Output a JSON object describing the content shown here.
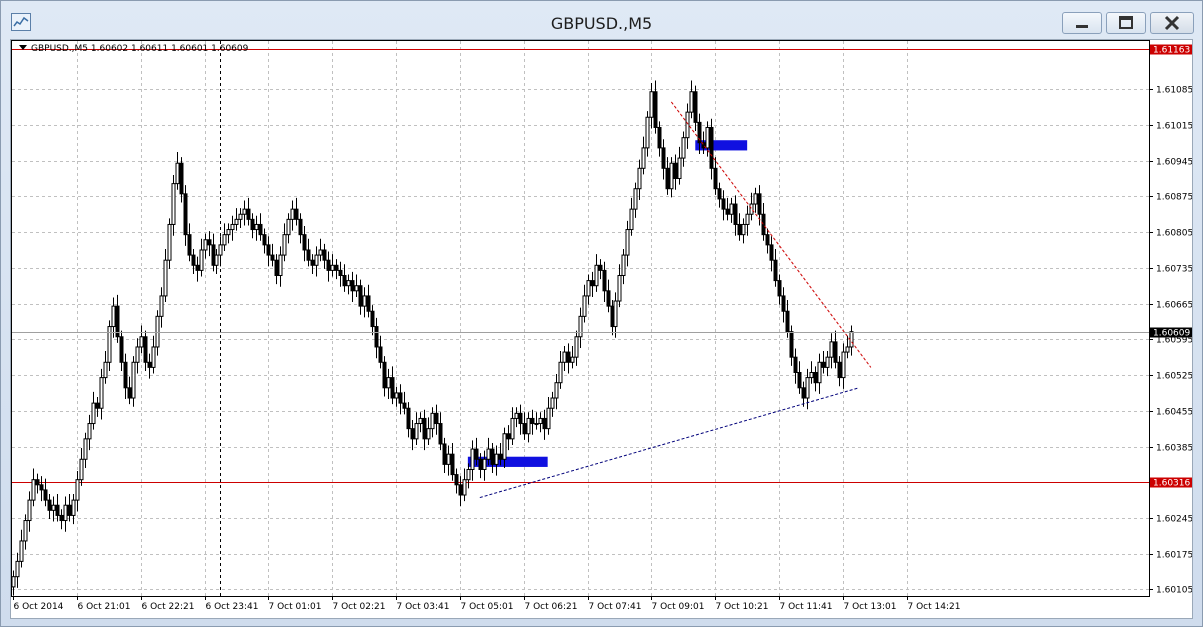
{
  "window": {
    "title": "GBPUSD.,M5",
    "icons": {
      "app": "chart-window-icon",
      "minimize": "minimize-icon",
      "maximize": "maximize-icon",
      "close": "close-icon"
    }
  },
  "chart_header": {
    "symbol": "GBPUSD.,M5",
    "ohlc": "1.60602 1.60611 1.60601 1.60609"
  },
  "colors": {
    "candle": "#000000",
    "level_line": "#cc0000",
    "trendline": "#00007a",
    "rect": "#1010e0",
    "grid": "#c0c0c0",
    "current_price_bg": "#000000"
  },
  "chart_data": {
    "type": "candlestick",
    "symbol": "GBPUSD.",
    "timeframe": "M5",
    "ylim": [
      1.601,
      1.6115
    ],
    "price_axis_labels": [
      "1.61085",
      "1.61015",
      "1.60945",
      "1.60875",
      "1.60805",
      "1.60735",
      "1.60665",
      "1.60595",
      "1.60525",
      "1.60455",
      "1.60385",
      "1.60315",
      "1.60245",
      "1.60175",
      "1.60105"
    ],
    "time_axis_labels": [
      "6 Oct 2014",
      "6 Oct 21:01",
      "6 Oct 22:21",
      "6 Oct 23:41",
      "7 Oct 01:01",
      "7 Oct 02:21",
      "7 Oct 03:41",
      "7 Oct 05:01",
      "7 Oct 06:21",
      "7 Oct 07:41",
      "7 Oct 09:01",
      "7 Oct 10:21",
      "7 Oct 11:41",
      "7 Oct 13:01",
      "7 Oct 14:21"
    ],
    "bars_per_label": 16,
    "horizontal_levels": [
      {
        "price": 1.61163,
        "label": "1.61163"
      },
      {
        "price": 1.60316,
        "label": "1.60316"
      }
    ],
    "current_price": {
      "price": 1.60609,
      "label": "1.60609"
    },
    "rectangles": [
      {
        "start_bar": 114,
        "end_bar": 134,
        "price_top": 1.60365,
        "price_bottom": 1.60345
      },
      {
        "start_bar": 171,
        "end_bar": 184,
        "price_top": 1.60985,
        "price_bottom": 1.60965
      }
    ],
    "trendlines": [
      {
        "bar1": 117,
        "price1": 1.60285,
        "bar2": 212,
        "price2": 1.605,
        "style": "dashed",
        "color": "#00007a"
      },
      {
        "bar1": 165,
        "price1": 1.6106,
        "bar2": 215,
        "price2": 1.6054,
        "style": "dashed",
        "color": "#cc0000"
      }
    ],
    "period_separator_bar": 52,
    "closes": [
      1.6013,
      1.6016,
      1.602,
      1.6024,
      1.6028,
      1.6032,
      1.6031,
      1.603,
      1.6028,
      1.6026,
      1.6027,
      1.6025,
      1.6024,
      1.6027,
      1.6025,
      1.6028,
      1.6032,
      1.6036,
      1.604,
      1.6043,
      1.6047,
      1.6046,
      1.6052,
      1.6055,
      1.6062,
      1.6066,
      1.606,
      1.6055,
      1.605,
      1.6048,
      1.6055,
      1.6058,
      1.606,
      1.6055,
      1.6054,
      1.6058,
      1.6064,
      1.6068,
      1.6075,
      1.6082,
      1.609,
      1.6094,
      1.6088,
      1.608,
      1.6076,
      1.6074,
      1.6073,
      1.6077,
      1.6079,
      1.6078,
      1.6074,
      1.6076,
      1.6078,
      1.608,
      1.6081,
      1.6082,
      1.6083,
      1.6084,
      1.6085,
      1.6083,
      1.6081,
      1.6082,
      1.608,
      1.6078,
      1.6076,
      1.6075,
      1.6072,
      1.6076,
      1.608,
      1.6083,
      1.6085,
      1.6083,
      1.608,
      1.6077,
      1.6075,
      1.6074,
      1.6076,
      1.6077,
      1.6075,
      1.6073,
      1.6074,
      1.6073,
      1.6072,
      1.607,
      1.6071,
      1.6069,
      1.607,
      1.6066,
      1.6068,
      1.6065,
      1.6062,
      1.6058,
      1.6055,
      1.605,
      1.6052,
      1.6048,
      1.6049,
      1.6047,
      1.6046,
      1.6042,
      1.604,
      1.6043,
      1.6044,
      1.604,
      1.6042,
      1.6045,
      1.6043,
      1.6039,
      1.6035,
      1.6037,
      1.6033,
      1.6031,
      1.6029,
      1.6032,
      1.6034,
      1.6038,
      1.6036,
      1.6034,
      1.6036,
      1.6038,
      1.6035,
      1.6037,
      1.6036,
      1.6041,
      1.604,
      1.6044,
      1.6045,
      1.6043,
      1.6041,
      1.6044,
      1.6043,
      1.6043,
      1.6044,
      1.6042,
      1.6046,
      1.6048,
      1.6051,
      1.6055,
      1.6057,
      1.6055,
      1.6056,
      1.606,
      1.6064,
      1.6068,
      1.6071,
      1.607,
      1.6074,
      1.6073,
      1.6069,
      1.6066,
      1.6062,
      1.6067,
      1.6072,
      1.6076,
      1.6081,
      1.6085,
      1.6089,
      1.6093,
      1.6097,
      1.6103,
      1.6108,
      1.6101,
      1.6097,
      1.6093,
      1.6089,
      1.6094,
      1.6091,
      1.6095,
      1.6099,
      1.6104,
      1.6108,
      1.6102,
      1.6098,
      1.6097,
      1.6101,
      1.6093,
      1.6089,
      1.6087,
      1.6085,
      1.6084,
      1.6086,
      1.6082,
      1.608,
      1.6082,
      1.6084,
      1.6086,
      1.6088,
      1.6084,
      1.608,
      1.6078,
      1.6075,
      1.6071,
      1.6068,
      1.6065,
      1.6061,
      1.6056,
      1.6053,
      1.605,
      1.6048,
      1.6052,
      1.6053,
      1.6051,
      1.6055,
      1.6054,
      1.6056,
      1.6059,
      1.6055,
      1.6052,
      1.6057,
      1.6058,
      1.6061
    ]
  }
}
